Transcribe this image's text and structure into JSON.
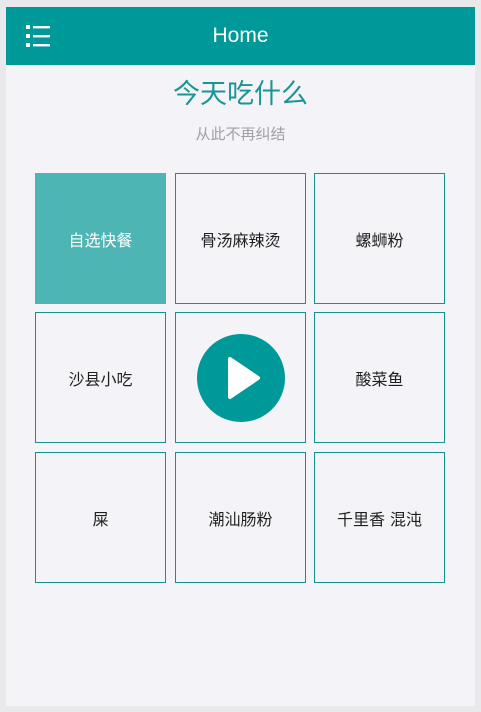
{
  "header": {
    "title": "Home",
    "menu_icon": "list-menu-icon"
  },
  "main": {
    "title": "今天吃什么",
    "subtitle": "从此不再纠结"
  },
  "grid": {
    "items": [
      {
        "label": "自选快餐",
        "selected": true
      },
      {
        "label": "骨汤麻辣烫",
        "selected": false
      },
      {
        "label": "螺蛳粉",
        "selected": false
      },
      {
        "label": "沙县小吃",
        "selected": false
      },
      {
        "label": "",
        "icon": "play-icon",
        "role": "start"
      },
      {
        "label": "酸菜鱼",
        "selected": false
      },
      {
        "label": "屎",
        "selected": false
      },
      {
        "label": "潮汕肠粉",
        "selected": false
      },
      {
        "label": "千里香 混沌",
        "selected": false
      }
    ]
  },
  "colors": {
    "primary": "#009999",
    "selected_background": "#4db6b5",
    "border": "#18908f",
    "page_background": "#f4f4f8",
    "title_text": "#1b9494",
    "subtitle_text": "#a0a0a5"
  }
}
